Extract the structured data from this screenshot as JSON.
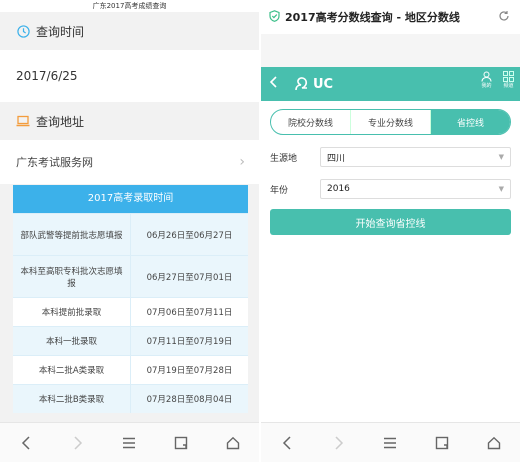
{
  "left": {
    "page_title": "广东2017高考成绩查询",
    "query_time_label": "查询时间",
    "query_time_value": "2017/6/25",
    "query_address_label": "查询地址",
    "query_address_value": "广东考试服务网",
    "table": {
      "title": "2017高考录取时间",
      "rows": [
        {
          "batch": "部队武警等提前批志愿填报",
          "time": "06月26日至06月27日"
        },
        {
          "batch": "本科至高职专科批次志愿填报",
          "time": "06月27日至07月01日"
        },
        {
          "batch": "本科提前批录取",
          "time": "07月06日至07月11日"
        },
        {
          "batch": "本科一批录取",
          "time": "07月11日至07月19日"
        },
        {
          "batch": "本科二批A类录取",
          "time": "07月19日至07月28日"
        },
        {
          "batch": "本科二批B类录取",
          "time": "07月28日至08月04日"
        }
      ]
    },
    "icons": {
      "clock": "clock-icon",
      "laptop": "laptop-icon",
      "chevron": "chevron-right-icon"
    },
    "accent_color": "#3cb1ea"
  },
  "right": {
    "window_title": "2017高考分数线查询 - 地区分数线",
    "brand": "UC",
    "header_icons": [
      {
        "name": "user-icon",
        "label": "我的"
      },
      {
        "name": "grid-icon",
        "label": "频道"
      }
    ],
    "tabs": [
      {
        "label": "院校分数线",
        "active": false
      },
      {
        "label": "专业分数线",
        "active": false
      },
      {
        "label": "省控线",
        "active": true
      }
    ],
    "origin_label": "生源地",
    "origin_value": "四川",
    "year_label": "年份",
    "year_value": "2016",
    "submit_label": "开始查询省控线",
    "accent_color": "#48bfae"
  },
  "nav_icons": [
    "back-icon",
    "forward-icon",
    "menu-icon",
    "tabs-icon",
    "home-icon"
  ]
}
